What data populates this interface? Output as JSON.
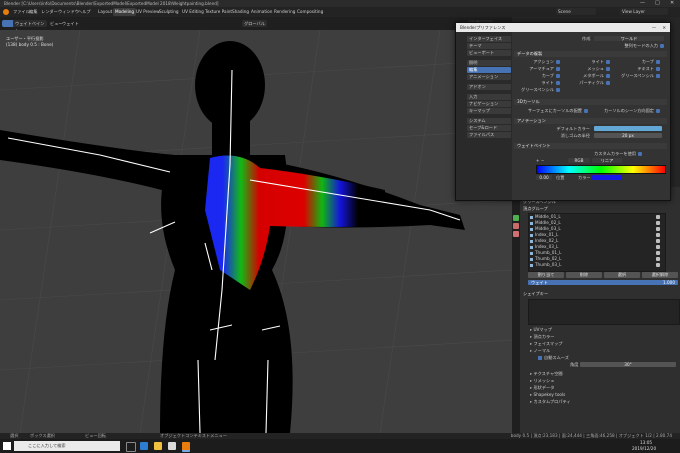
{
  "titlebar": {
    "title": "Blender [C:\\Users\\info\\Documents\\Blender\\ExportedModel\\ExportedModel 2018\\Weightpainting.blend]",
    "min": "—",
    "max": "□",
    "close": "✕"
  },
  "menu": {
    "items": [
      "ファイル",
      "編集",
      "レンダー",
      "ウィンドウ",
      "ヘルプ"
    ],
    "workspaces": [
      "Layout",
      "Modeling",
      "UV Preview",
      "Sculpting",
      "UV Editing",
      "Texture Paint",
      "Shading",
      "Animation",
      "Rendering",
      "Compositing"
    ],
    "active_workspace": "Modeling",
    "scene": "Scene",
    "view_layer": "View Layer"
  },
  "viewport_header": {
    "mode": "ウェイトペイント",
    "view": "ビュー",
    "weights": "ウェイト",
    "transform": "グローバル",
    "options": "オプション"
  },
  "viewport": {
    "view_name": "ユーザー・平行投影",
    "object_info": "(138) body 0.5 : Bone)"
  },
  "prefs": {
    "title": "Blenderプリファレンス",
    "nav": [
      "インターフェイス",
      "テーマ",
      "ビューポート",
      "照明",
      "編集",
      "アニメーション",
      "アドオン",
      "入力",
      "ナビゲーション",
      "キーマップ",
      "システム",
      "セーブ&ロード",
      "ファイルパス"
    ],
    "active_nav": "編集",
    "top_label": "作成",
    "top_value": "ワールド",
    "top_check": "整列モードの入力",
    "sec1": "データの複製",
    "dup_items": [
      [
        "アクション",
        "ライト",
        "カーブ"
      ],
      [
        "アーマチュア",
        "メッシュ",
        "テキスト"
      ],
      [
        "カーブ",
        "メタボール",
        "グリースペンシル"
      ],
      [
        "ライト",
        "パーティクル",
        ""
      ],
      [
        "グリースペンシル",
        "",
        ""
      ]
    ],
    "sec2": "3Dカーソル",
    "cursor_a": "サーフェスにカーソルの配置",
    "cursor_b": "カーソルのシーン方向固定",
    "sec3": "アノテーション",
    "default_color_label": "デフォルトカラー",
    "eraser_label": "消しゴムの半径",
    "eraser_value": "20 px",
    "sec4": "ウェイトペイント",
    "custom_weight": "カスタムカラーを使用",
    "ramp_pos": "0.00",
    "ramp_mode": "RGB",
    "ramp_interp": "リニア",
    "ramp_sel": "位置",
    "ramp_col": "カラー"
  },
  "props": {
    "grease": "グリースペンシル",
    "vg_header": "頂点グループ",
    "vertex_groups": [
      "Middle_01_L",
      "Middle_02_L",
      "Middle_03_L",
      "Index_01_L",
      "Index_02_L",
      "Index_03_L",
      "Thumb_01_L",
      "Thumb_02_L",
      "Thumb_03_L"
    ],
    "buttons": [
      "割り当て",
      "削除",
      "選択",
      "選択解除"
    ],
    "weight_label": "ウェイト",
    "weight_value": "1.000",
    "shapekeys": "シェイプキー",
    "sub_sections": [
      "UVマップ",
      "頂点カラー",
      "フェイスマップ",
      "ノーマル",
      "テクスチャ空間",
      "リメッシュ",
      "形状データ",
      "Shapekey tools",
      "カスタムプロパティ"
    ],
    "autosmooth": "自動スムーズ",
    "angle_label": "角度",
    "angle_value": "30°"
  },
  "statusbar": {
    "left": "選択",
    "mid": "ボックス選択",
    "mid2": "ビュー回転",
    "mid3": "オブジェクトコンテキストメニュー",
    "right": "body 0.5 | 頂点:23,183 | 面:24,444 | 三角面:46,258 | オブジェクト 1/2 | 2.80.74"
  },
  "taskbar": {
    "search_placeholder": "ここに入力して検索",
    "time": "13:05",
    "date": "2019/12/20"
  },
  "colors": {
    "accent": "#4772b3",
    "viewport_bg": "#3e3e3e",
    "annotation_color": "#62a7d6"
  }
}
